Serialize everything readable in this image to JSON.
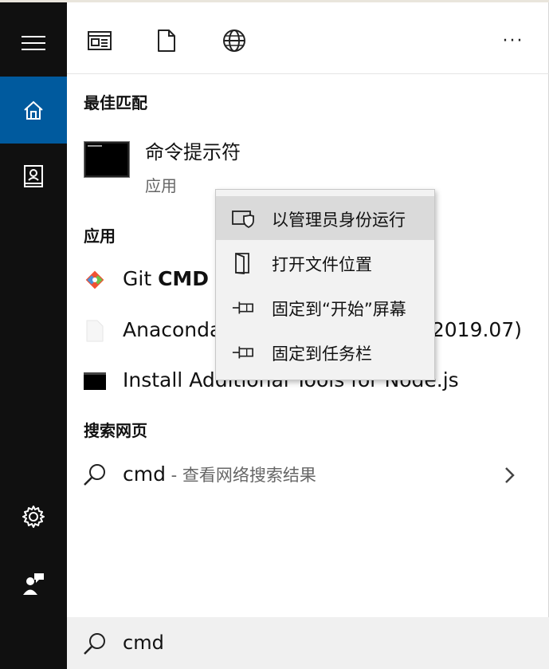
{
  "toolbar": {
    "icons": [
      "document-view-icon",
      "file-icon",
      "globe-icon"
    ],
    "more_label": "···"
  },
  "sidebar": {
    "items": [
      "hamburger-icon",
      "home-icon",
      "notebook-icon",
      "settings-icon",
      "user-feedback-icon"
    ]
  },
  "best_match": {
    "heading": "最佳匹配",
    "title": "命令提示符",
    "subtitle": "应用"
  },
  "apps": {
    "heading": "应用",
    "items": [
      {
        "prefix": "Git ",
        "bold": "CMD",
        "icon": "git-icon"
      },
      {
        "label": "Anaconda Prompt (Anaconda3 2019.07)",
        "icon": "blank-file-icon"
      },
      {
        "label": "Install Additional Tools for Node.js",
        "icon": "console-icon"
      }
    ]
  },
  "web": {
    "heading": "搜索网页",
    "query": "cmd",
    "hint": " - 查看网络搜索结果"
  },
  "search": {
    "value": "cmd"
  },
  "context_menu": {
    "items": [
      {
        "label": "以管理员身份运行",
        "icon": "shield-icon"
      },
      {
        "label": "打开文件位置",
        "icon": "open-folder-icon"
      },
      {
        "label": "固定到“开始”屏幕",
        "icon": "pin-icon"
      },
      {
        "label": "固定到任务栏",
        "icon": "pin-icon"
      }
    ]
  }
}
